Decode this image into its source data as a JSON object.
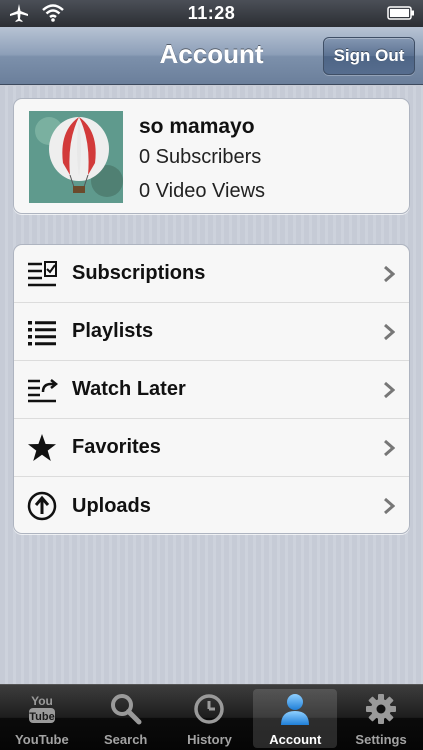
{
  "status_bar": {
    "time": "11:28",
    "icons": [
      "airplane-icon",
      "wifi-icon",
      "battery-icon"
    ]
  },
  "nav_bar": {
    "title": "Account",
    "sign_out_label": "Sign Out"
  },
  "profile": {
    "username": "so mamayo",
    "subscribers": "0 Subscribers",
    "video_views": "0 Video Views",
    "avatar": "hot-air-balloon-image"
  },
  "menu": {
    "items": [
      {
        "label": "Subscriptions",
        "icon": "subscriptions-icon"
      },
      {
        "label": "Playlists",
        "icon": "playlist-icon"
      },
      {
        "label": "Watch Later",
        "icon": "watch-later-icon"
      },
      {
        "label": "Favorites",
        "icon": "star-icon"
      },
      {
        "label": "Uploads",
        "icon": "upload-icon"
      }
    ]
  },
  "tab_bar": {
    "tabs": [
      {
        "label": "YouTube",
        "icon": "youtube-icon",
        "active": false
      },
      {
        "label": "Search",
        "icon": "search-icon",
        "active": false
      },
      {
        "label": "History",
        "icon": "history-icon",
        "active": false
      },
      {
        "label": "Account",
        "icon": "account-icon",
        "active": true
      },
      {
        "label": "Settings",
        "icon": "gear-icon",
        "active": false
      }
    ]
  },
  "colors": {
    "nav_bar": "#8d9fb8",
    "tab_active": "#4da3e6",
    "background": "#c8ccd6"
  }
}
